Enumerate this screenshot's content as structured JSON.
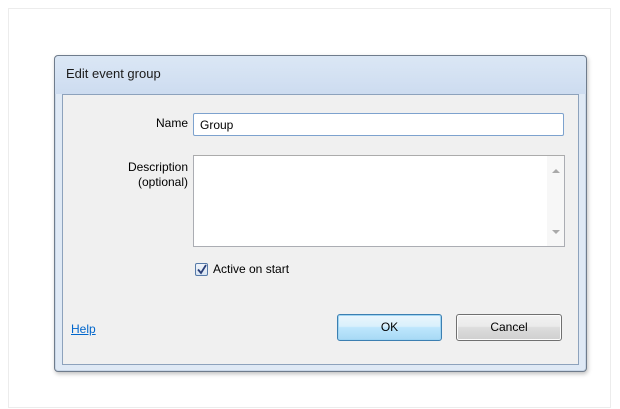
{
  "dialog": {
    "title": "Edit event group",
    "name_label": "Name",
    "name_value": "Group",
    "description_label_line1": "Description",
    "description_label_line2": "(optional)",
    "description_value": "",
    "active_on_start_label": "Active on start",
    "active_on_start_checked": true,
    "help_link": "Help",
    "ok_label": "OK",
    "cancel_label": "Cancel"
  }
}
